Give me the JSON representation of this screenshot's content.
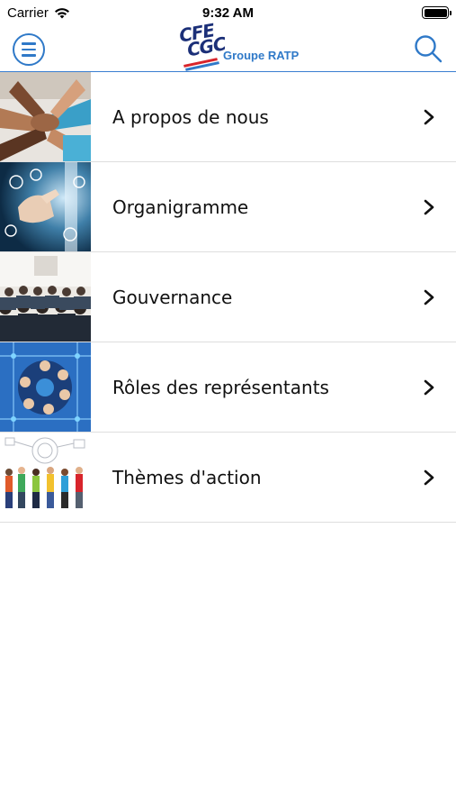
{
  "status_bar": {
    "carrier": "Carrier",
    "time": "9:32 AM"
  },
  "header": {
    "logo_mark_line1": "CFE",
    "logo_mark_line2": "CGC",
    "logo_text": "Groupe RATP",
    "menu_icon": "hamburger-menu-icon",
    "search_icon": "search-icon"
  },
  "menu": {
    "items": [
      {
        "label": "A propos de nous",
        "image": "stacked-hands-photo"
      },
      {
        "label": "Organigramme",
        "image": "touchscreen-hand-photo"
      },
      {
        "label": "Gouvernance",
        "image": "conference-audience-photo"
      },
      {
        "label": "Rôles des représentants",
        "image": "network-people-circle-photo"
      },
      {
        "label": "Thèmes d'action",
        "image": "people-group-illustration"
      }
    ]
  },
  "colors": {
    "accent": "#2f79c8",
    "logo_navy": "#1b2f78",
    "logo_red": "#d8242b",
    "divider": "#dedede"
  }
}
